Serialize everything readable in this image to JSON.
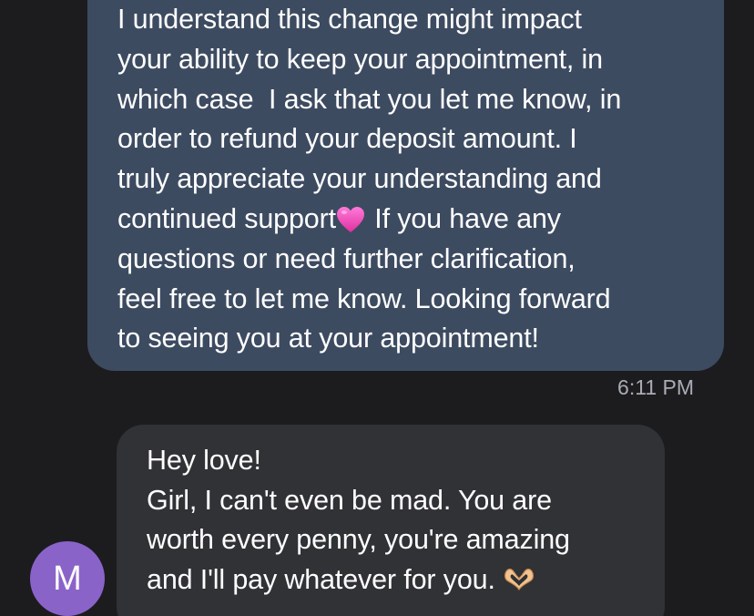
{
  "sent_message": {
    "lines": [
      "I understand this change might impact",
      "your ability to keep your appointment, in",
      "which case  I ask that you let me know, in",
      "order to refund your deposit amount. I",
      "truly appreciate your understanding and",
      "continued support",
      " If you have any",
      "questions or need further clarification,",
      "feel free to let me know. Looking forward",
      "to seeing you at your appointment!"
    ],
    "heart_icon": "pink-heart-icon",
    "bubble_color": "#3d4b61"
  },
  "timestamp": "6:11 PM",
  "received_message": {
    "lines": [
      "Hey love!",
      "Girl, I can't even be mad. You are",
      "worth every penny, you're amazing",
      "and I'll pay whatever for you."
    ],
    "hands_icon": "heart-hands-icon",
    "bubble_color": "#303236"
  },
  "avatar": {
    "initial": "M",
    "color": "#8a63c9"
  }
}
